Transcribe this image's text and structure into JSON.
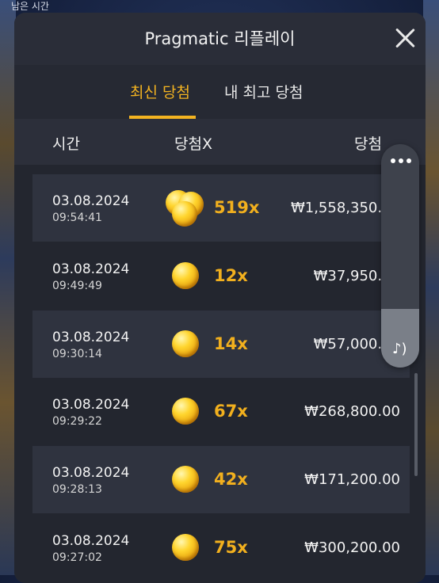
{
  "background": {
    "top_label": "남은 시간"
  },
  "modal": {
    "title": "Pragmatic 리플레이",
    "tabs": [
      {
        "label": "최신 당첨",
        "active": true
      },
      {
        "label": "내 최고 당첨",
        "active": false
      }
    ],
    "columns": {
      "time": "시간",
      "multiplier": "당첨X",
      "win": "당첨"
    },
    "rows": [
      {
        "date": "03.08.2024",
        "time": "09:54:41",
        "multiplier": "519x",
        "win": "₩1,558,350.00",
        "coin": "stack"
      },
      {
        "date": "03.08.2024",
        "time": "09:49:49",
        "multiplier": "12x",
        "win": "₩37,950.00",
        "coin": "single"
      },
      {
        "date": "03.08.2024",
        "time": "09:30:14",
        "multiplier": "14x",
        "win": "₩57,000.00",
        "coin": "single"
      },
      {
        "date": "03.08.2024",
        "time": "09:29:22",
        "multiplier": "67x",
        "win": "₩268,800.00",
        "coin": "single"
      },
      {
        "date": "03.08.2024",
        "time": "09:28:13",
        "multiplier": "42x",
        "win": "₩171,200.00",
        "coin": "single"
      },
      {
        "date": "03.08.2024",
        "time": "09:27:02",
        "multiplier": "75x",
        "win": "₩300,200.00",
        "coin": "single"
      }
    ]
  },
  "floating_menu": {
    "menu_icon": "more-dots-icon",
    "music_icon": "music-note-icon"
  },
  "colors": {
    "accent": "#f3b321",
    "panel": "#2a2d38",
    "row": "#2f333f"
  }
}
